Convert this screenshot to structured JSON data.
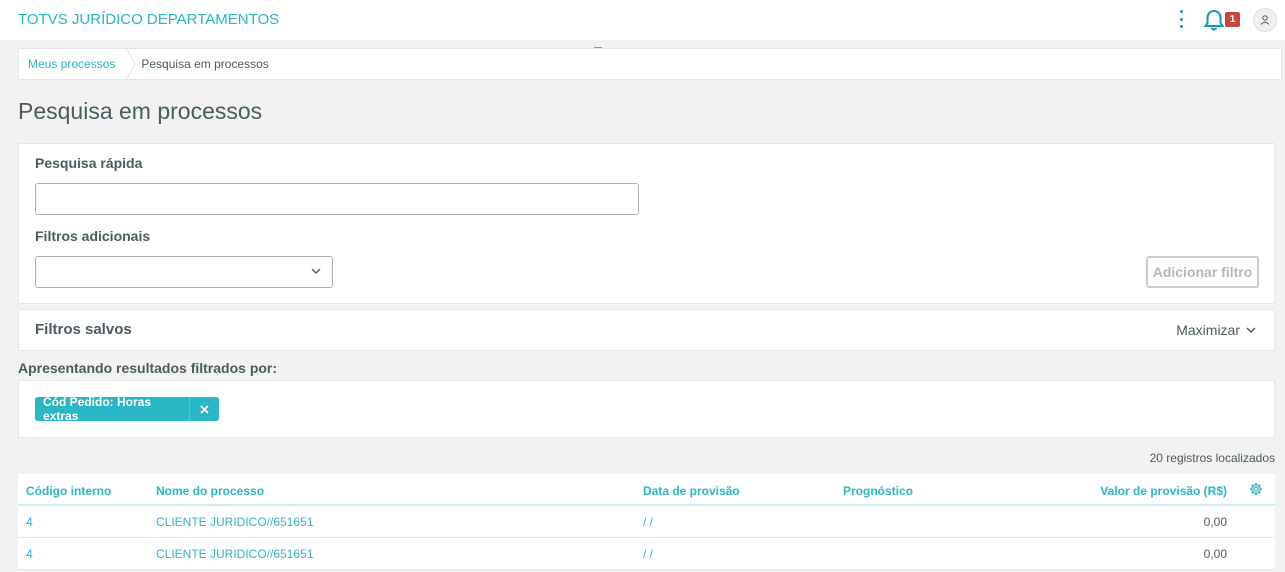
{
  "app": {
    "title": "TOTVS JURÍDICO DEPARTAMENTOS",
    "notification_count": "1"
  },
  "breadcrumb": {
    "items": [
      "Meus processos",
      "Pesquisa em processos"
    ]
  },
  "page": {
    "title": "Pesquisa em processos"
  },
  "search": {
    "quick_label": "Pesquisa rápida",
    "quick_value": "",
    "filters_label": "Filtros adicionais",
    "filters_value": "",
    "add_filter_label": "Adicionar filtro"
  },
  "saved_filters": {
    "title": "Filtros salvos",
    "maximize_label": "Maximizar"
  },
  "results": {
    "label": "Apresentando resultados filtrados por:",
    "chips": [
      {
        "label": "Cód Pedido: Horas extras"
      }
    ],
    "count_label": "20 registros localizados"
  },
  "table": {
    "columns": [
      "Código interno",
      "Nome do processo",
      "Data de provisão",
      "Prognóstico",
      "Valor de provisão (R$)"
    ],
    "rows": [
      [
        "4",
        "CLIENTE JURIDICO//651651",
        "/ /",
        "",
        "0,00"
      ],
      [
        "4",
        "CLIENTE JURIDICO//651651",
        "/ /",
        "",
        "0,00"
      ]
    ]
  },
  "colors": {
    "accent": "#29b6c5",
    "badge": "#c64840",
    "text": "#4a5c60",
    "progress": "#2bd66a"
  },
  "icons": [
    "kebab-menu-icon",
    "bell-icon",
    "user-icon",
    "chevron-down-icon",
    "close-icon",
    "gear-icon"
  ]
}
